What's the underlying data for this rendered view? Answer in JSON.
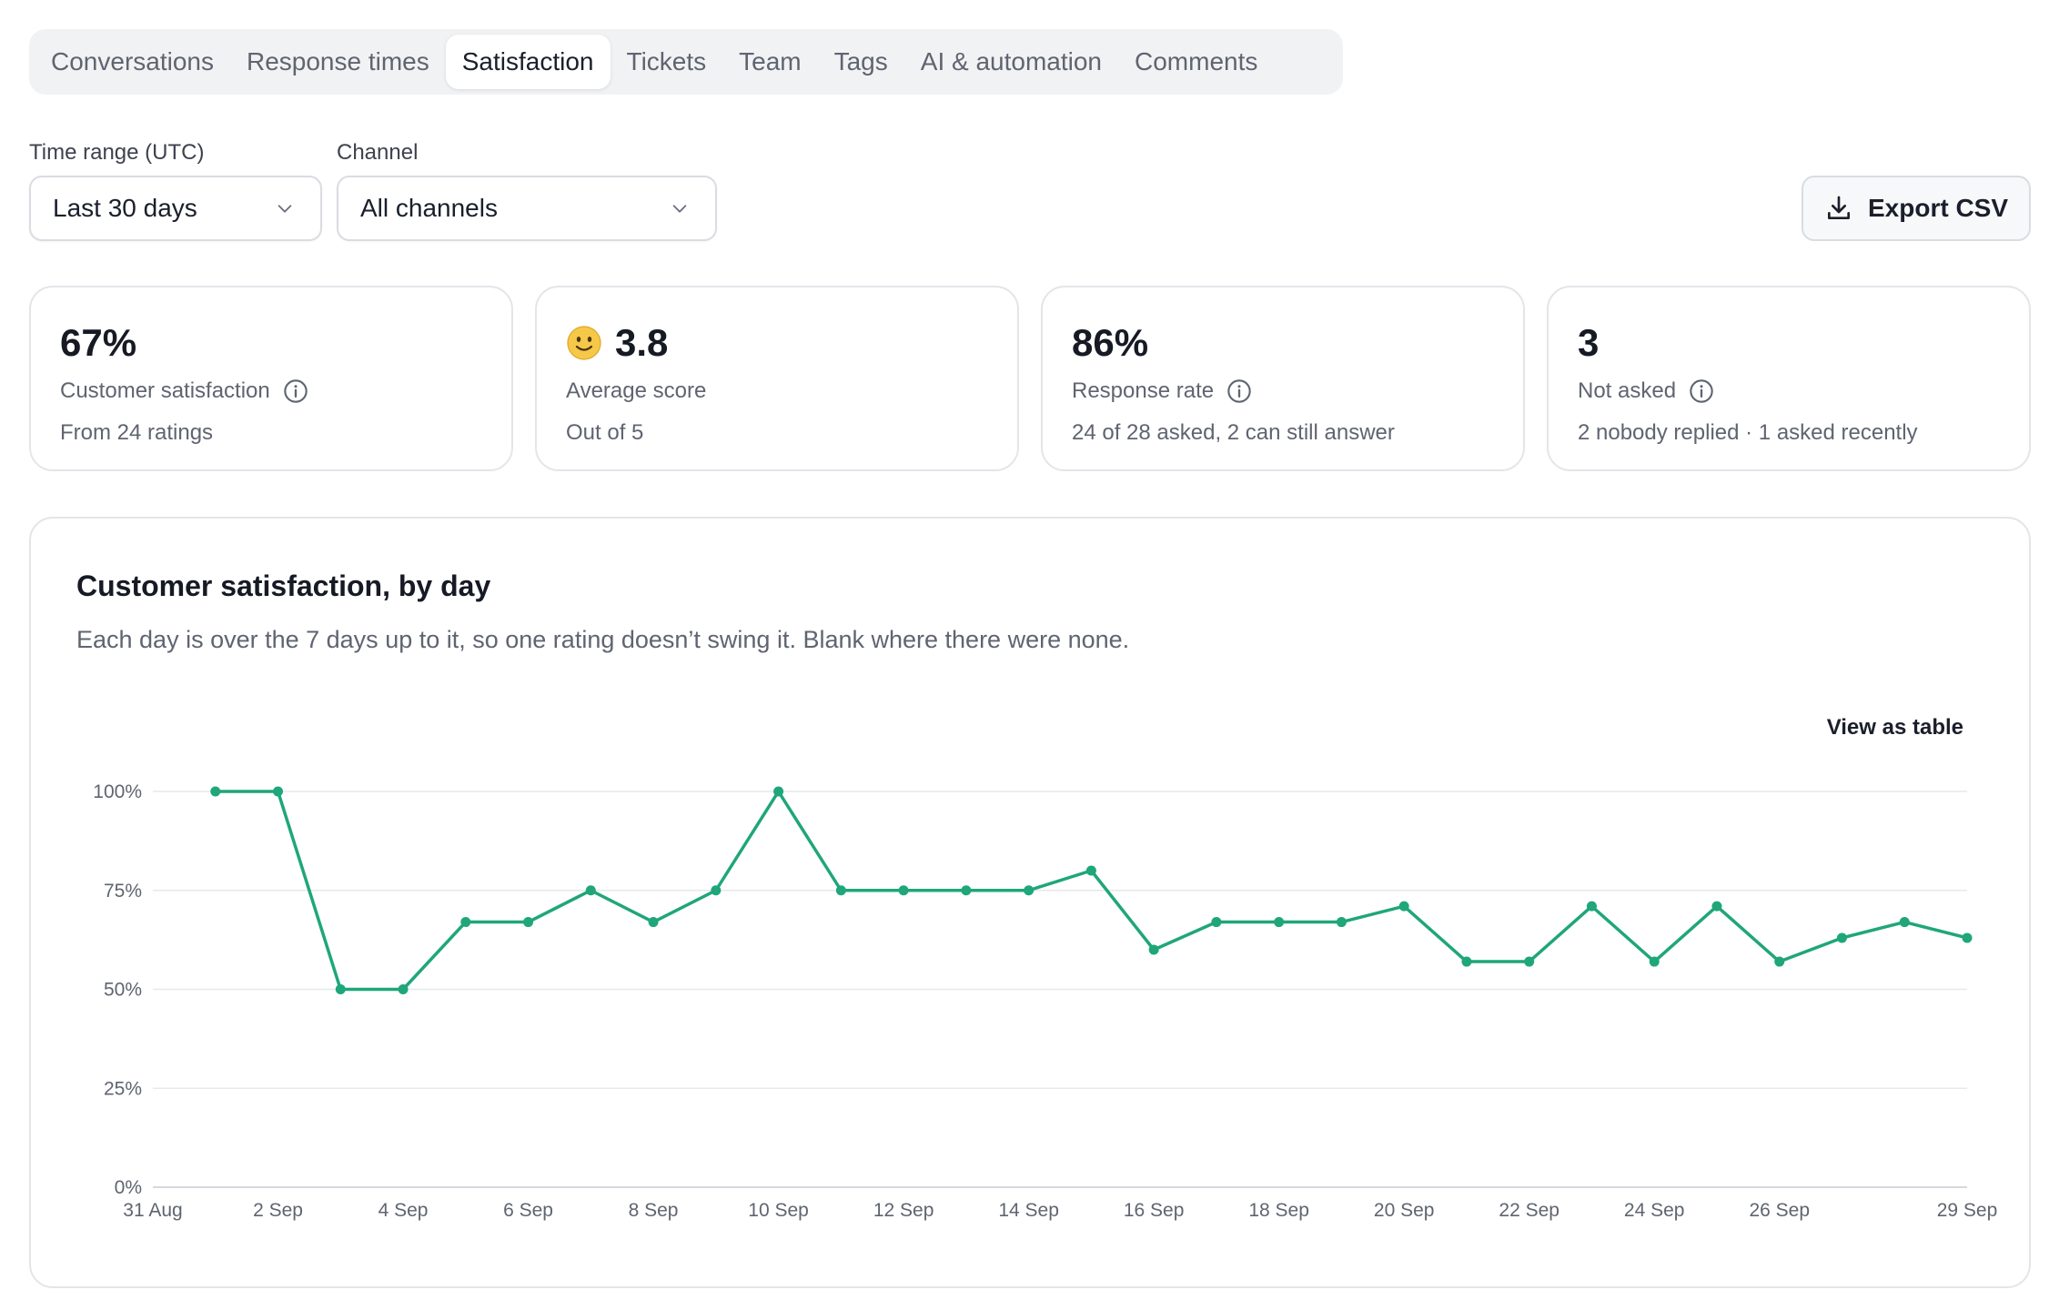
{
  "tabs": [
    {
      "label": "Conversations",
      "active": false
    },
    {
      "label": "Response times",
      "active": false
    },
    {
      "label": "Satisfaction",
      "active": true
    },
    {
      "label": "Tickets",
      "active": false
    },
    {
      "label": "Team",
      "active": false
    },
    {
      "label": "Tags",
      "active": false
    },
    {
      "label": "AI & automation",
      "active": false
    },
    {
      "label": "Comments",
      "active": false
    }
  ],
  "filters": {
    "time_range": {
      "label": "Time range (UTC)",
      "value": "Last 30 days"
    },
    "channel": {
      "label": "Channel",
      "value": "All channels"
    }
  },
  "export_label": "Export CSV",
  "cards": [
    {
      "value": "67%",
      "label": "Customer satisfaction",
      "sub": "From 24 ratings",
      "info": true,
      "emoji": false
    },
    {
      "value": "3.8",
      "label": "Average score",
      "sub": "Out of 5",
      "info": false,
      "emoji": true
    },
    {
      "value": "86%",
      "label": "Response rate",
      "sub": "24 of 28 asked, 2 can still answer",
      "info": true,
      "emoji": false
    },
    {
      "value": "3",
      "label": "Not asked",
      "sub": "2 nobody replied · 1 asked recently",
      "info": true,
      "emoji": false
    }
  ],
  "chart": {
    "title": "Customer satisfaction, by day",
    "subtitle": "Each day is over the 7 days up to it, so one rating doesn’t swing it. Blank where there were none.",
    "view_table_label": "View as table"
  },
  "colors": {
    "line": "#1fa67a",
    "grid": "#e6e8eb",
    "axis": "#c9ccd2"
  },
  "chart_data": {
    "type": "line",
    "x_start": "2024-08-31",
    "x": [
      "1 Sep",
      "2 Sep",
      "3 Sep",
      "4 Sep",
      "5 Sep",
      "6 Sep",
      "7 Sep",
      "8 Sep",
      "9 Sep",
      "10 Sep",
      "11 Sep",
      "12 Sep",
      "13 Sep",
      "14 Sep",
      "15 Sep",
      "16 Sep",
      "17 Sep",
      "18 Sep",
      "19 Sep",
      "20 Sep",
      "21 Sep",
      "22 Sep",
      "23 Sep",
      "24 Sep",
      "25 Sep",
      "26 Sep",
      "27 Sep",
      "28 Sep",
      "29 Sep"
    ],
    "series": [
      {
        "name": "Customer satisfaction",
        "values": [
          100,
          100,
          50,
          50,
          67,
          67,
          75,
          67,
          75,
          100,
          75,
          75,
          75,
          75,
          80,
          60,
          67,
          67,
          67,
          71,
          57,
          57,
          71,
          57,
          71,
          57,
          63,
          67,
          63
        ]
      }
    ],
    "x_tick_labels": [
      "31 Aug",
      "2 Sep",
      "4 Sep",
      "6 Sep",
      "8 Sep",
      "10 Sep",
      "12 Sep",
      "14 Sep",
      "16 Sep",
      "18 Sep",
      "20 Sep",
      "22 Sep",
      "24 Sep",
      "26 Sep",
      "29 Sep"
    ],
    "y_tick_labels": [
      "0%",
      "25%",
      "50%",
      "75%",
      "100%"
    ],
    "ylim": [
      0,
      100
    ],
    "grid": true,
    "legend": "none"
  }
}
